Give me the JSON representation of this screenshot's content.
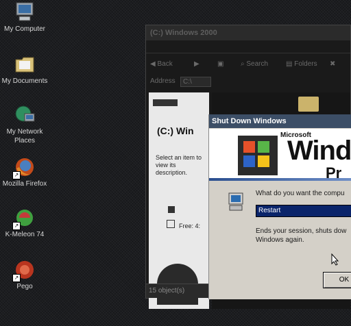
{
  "desktop": {
    "icons": [
      {
        "label": "My Computer",
        "icon": "my-computer-icon"
      },
      {
        "label": "My Documents",
        "icon": "folder-icon"
      },
      {
        "label": "My Network Places",
        "icon": "network-places-icon"
      },
      {
        "label": "Mozilla Firefox",
        "icon": "firefox-icon"
      },
      {
        "label": "K-Meleon 74",
        "icon": "k-meleon-icon"
      },
      {
        "label": "Pego",
        "icon": "pego-icon"
      }
    ]
  },
  "explorer": {
    "title": "(C:) Windows 2000",
    "toolbar": {
      "back": "Back",
      "search": "Search",
      "folders": "Folders"
    },
    "address_label": "Address",
    "address_value": "C:\\",
    "pane_title": "(C:) Win",
    "pane_text_1": "Select an item to view its description.",
    "pane_text_2": "Free: 4:",
    "status": "15 object(s)"
  },
  "shutdown_dialog": {
    "title": "Shut Down Windows",
    "brand_small": "Microsoft",
    "brand_big": "Windo",
    "brand_sub": "Pr",
    "question": "What do you want the compu",
    "selected_option": "Restart",
    "description": "Ends your session, shuts dow Windows again.",
    "ok_label": "OK"
  },
  "colors": {
    "title_bar": "#3c4e66",
    "dialog_face": "#d4d0c8",
    "selection": "#0a246a"
  }
}
